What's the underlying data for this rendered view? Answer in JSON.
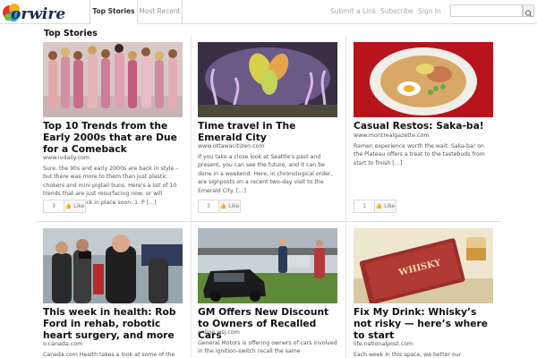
{
  "header": {
    "logo_text": "Newswire",
    "tabs": [
      {
        "label": "Top Stories",
        "active": true
      },
      {
        "label": "Most Recent",
        "active": false
      }
    ],
    "links": {
      "submit": "Submit a Link",
      "subscribe": "Subscribe",
      "signin": "Sign In"
    },
    "search": {
      "value": "",
      "icon": "search-icon"
    }
  },
  "section_title": "Top Stories",
  "stories": [
    {
      "title": "Top 10 Trends from the Early 2000s that are Due for a Comeback",
      "source": "www.ivdaily.com",
      "excerpt": "Sure, the 90s and early 2000s are back in style – but there was more to them than just plastic chokers and mini pigtail buns. Here's a list of 10 trends that are just resurfacing now, or will definitely be back in place soon. 1. P […]",
      "likes": "3",
      "like_label": "Like",
      "image": "group-of-women-photo"
    },
    {
      "title": "Time travel in The Emerald City",
      "source": "www.ottawacitizen.com",
      "excerpt": "If you take a close look at Seattle's past and present, you can see the future, and it can be done in a weekend. Here, in chronological order, are signposts on a recent two-day visit to the Emerald City. […]",
      "likes": "3",
      "like_label": "Like",
      "image": "glass-sculpture-photo"
    },
    {
      "title": "Casual Restos: Saka-ba!",
      "source": "www.montrealgazette.com",
      "excerpt": "Ramen experience worth the wait: Saka-ba! on the Plateau offers a treat to the tastebuds from start to finish […]",
      "likes": "1",
      "like_label": "Like",
      "image": "ramen-bowl-photo"
    },
    {
      "title": "This week in health: Rob Ford in rehab, robotic heart surgery, and more",
      "source": "o.canada.com",
      "excerpt": "Canada.com Health takes a look at some of the",
      "image": "press-scrum-photo"
    },
    {
      "title": "GM Offers New Discount to Owners of Recalled Cars",
      "source": "online.wsj.com",
      "excerpt": "General Motors is offering owners of cars involved in the ignition-switch recall the same",
      "image": "car-lot-photo"
    },
    {
      "title": "Fix My Drink: Whisky’s not risky — here’s where to start",
      "source": "life.nationalpost.com",
      "excerpt": "Each week in this space, we better our",
      "image": "whisky-book-photo"
    }
  ],
  "colors": {
    "accent_link": "#999999",
    "title_text": "#111111",
    "divider": "#e0e0e0"
  }
}
